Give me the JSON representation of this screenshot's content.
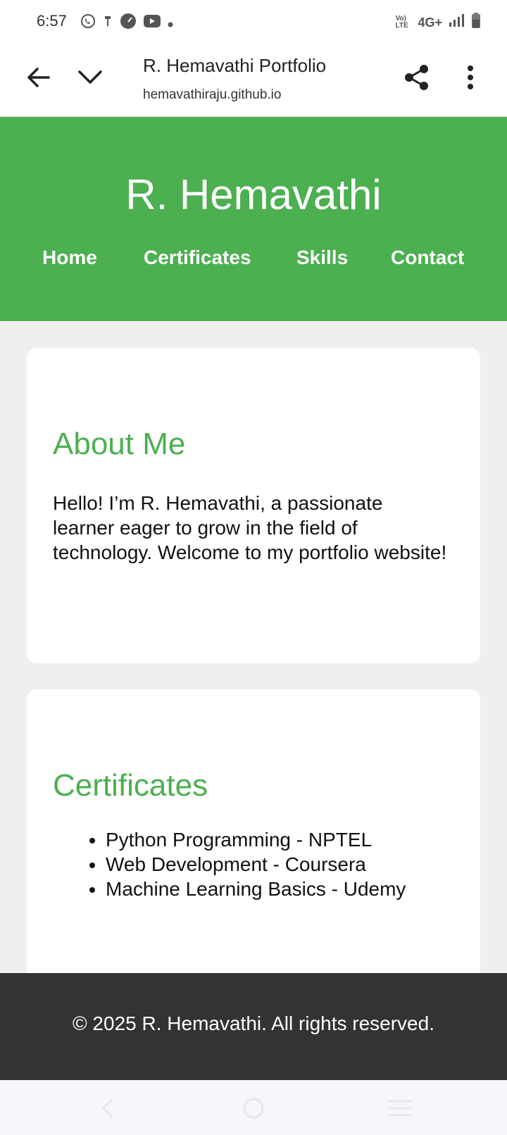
{
  "status_bar": {
    "time": "6:57",
    "left_icons": [
      "whatsapp-icon",
      "usb-icon",
      "speed-icon",
      "youtube-icon",
      "dot-icon"
    ],
    "network_label": "4G+",
    "volte_label": "Vo) LTE"
  },
  "browser": {
    "page_title": "R. Hemavathi Portfolio",
    "url": "hemavathiraju.github.io"
  },
  "header": {
    "site_title": "R. Hemavathi",
    "nav": [
      "Home",
      "Certificates",
      "Skills",
      "Contact"
    ],
    "color": "#4caf50"
  },
  "about": {
    "heading": "About Me",
    "text": "Hello! I’m R. Hemavathi, a passionate learner eager to grow in the field of technology. Welcome to my portfolio website!"
  },
  "certificates": {
    "heading": "Certificates",
    "items": [
      "Python Programming - NPTEL",
      "Web Development - Coursera",
      "Machine Learning Basics - Udemy"
    ]
  },
  "footer": {
    "text": "© 2025 R. Hemavathi. All rights reserved.",
    "color": "#333333"
  }
}
